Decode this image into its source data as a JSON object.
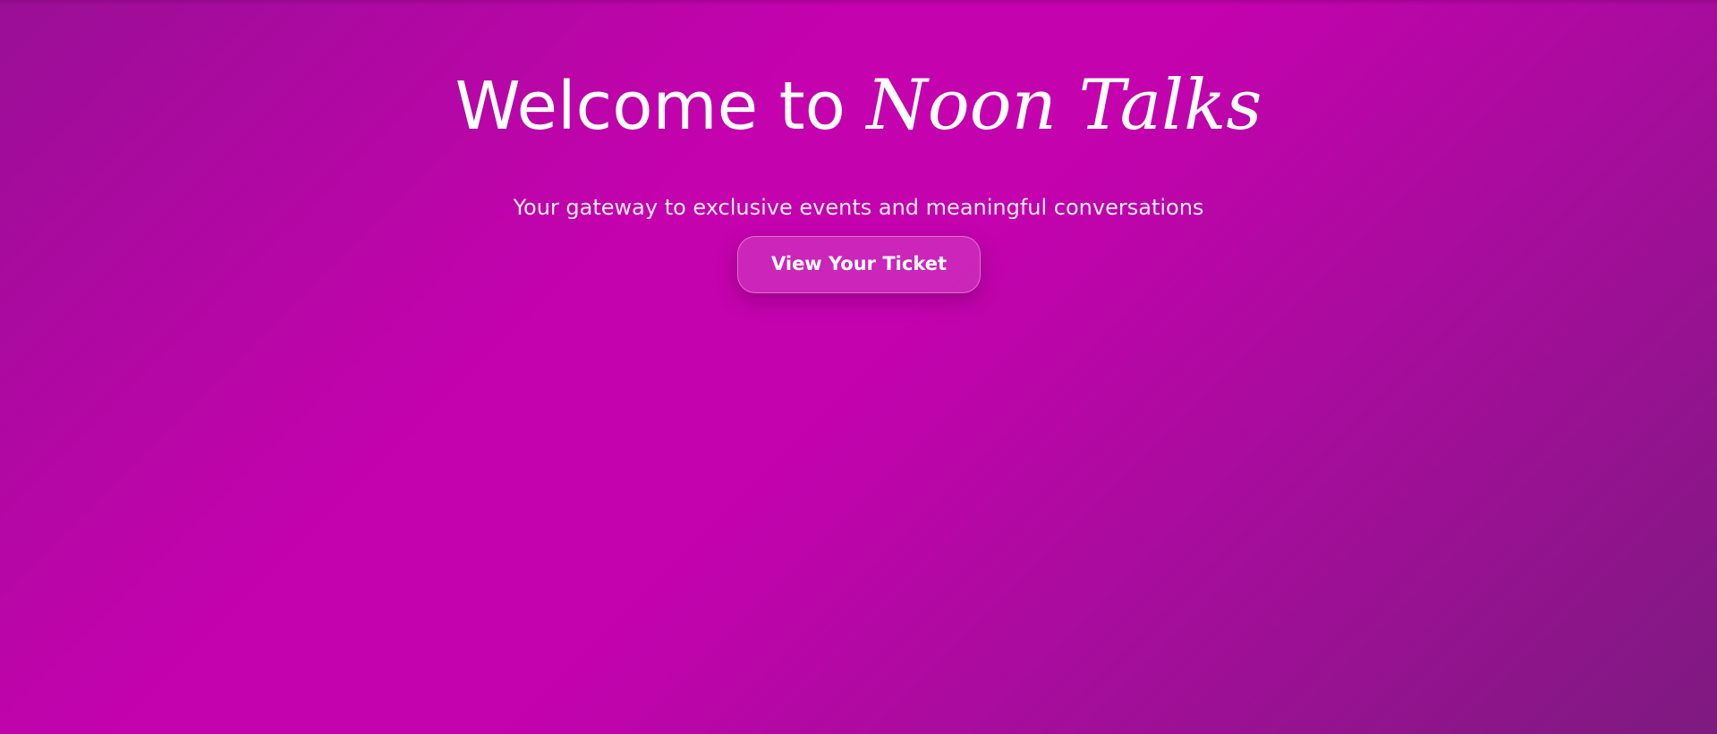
{
  "hero": {
    "title_prefix": "Welcome to ",
    "brand_name": "Noon Talks",
    "subtitle": "Your gateway to exclusive events and meaningful conversations",
    "cta_label": "View Your Ticket"
  },
  "colors": {
    "background_primary": "#c402ae",
    "background_dark": "#7e1a80",
    "text": "#ffffff"
  }
}
